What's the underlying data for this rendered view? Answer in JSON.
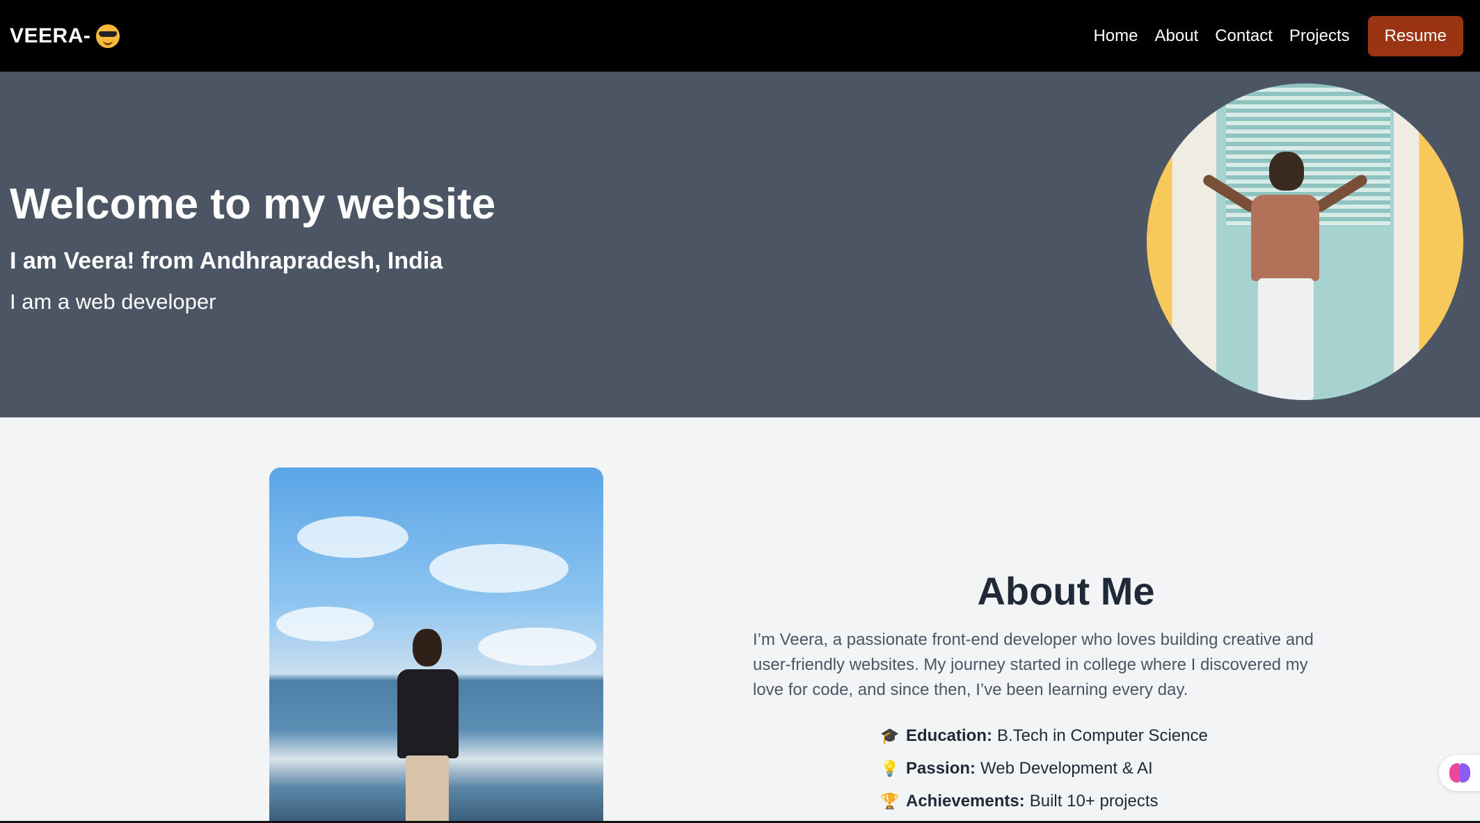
{
  "navbar": {
    "brand": "VEERA-",
    "brand_emoji": "sunglasses-face-icon",
    "links": [
      "Home",
      "About",
      "Contact",
      "Projects"
    ],
    "resume_label": "Resume"
  },
  "hero": {
    "title": "Welcome to my website",
    "subtitle": "I am Veera! from Andhrapradesh, India",
    "text": "I am a web developer"
  },
  "about": {
    "title": "About Me",
    "description": "I’m Veera, a passionate front-end developer who loves building creative and user-friendly websites. My journey started in college where I discovered my love for code, and since then, I’ve been learning every day.",
    "items": [
      {
        "icon": "graduation-cap-icon",
        "glyph": "🎓",
        "label": "Education:",
        "value": "B.Tech in Computer Science"
      },
      {
        "icon": "lightbulb-icon",
        "glyph": "💡",
        "label": "Passion:",
        "value": "Web Development & AI"
      },
      {
        "icon": "trophy-icon",
        "glyph": "🏆",
        "label": "Achievements:",
        "value": "Built 10+ projects"
      }
    ]
  },
  "colors": {
    "navbar_bg": "#000000",
    "hero_bg": "#4b5563",
    "resume_button": "#9a3412",
    "page_bg": "#f3f4f6"
  }
}
